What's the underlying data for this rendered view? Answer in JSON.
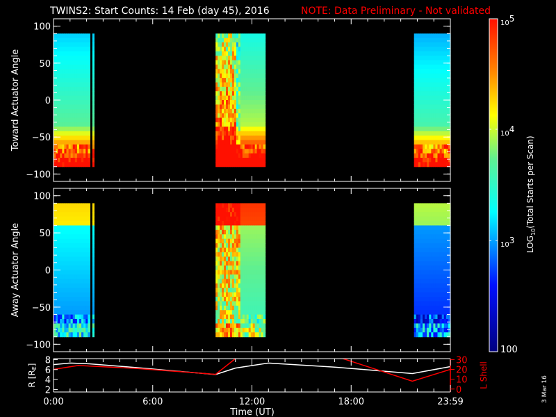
{
  "title": "TWINS2: Start Counts: 14 Feb (day  45), 2016",
  "note": "NOTE: Data Preliminary - Not validated",
  "date_stamp": "3 Mar 16",
  "colors": {
    "note": "#ff0000",
    "axis": "#ffffff",
    "lshell": "#ff0000",
    "r": "#ffffff"
  },
  "chart_data": [
    {
      "type": "heatmap",
      "name": "toward",
      "ylabel": "Toward Actuator Angle",
      "ylim": [
        -110,
        110
      ],
      "yticks": [
        "100",
        "50",
        "0",
        "−50",
        "−100"
      ],
      "ytick_values": [
        100,
        50,
        0,
        -50,
        -100
      ],
      "data_angle_range": [
        -90,
        90
      ],
      "data_intervals_hours": [
        [
          0,
          2.2
        ],
        [
          2.35,
          2.45
        ],
        [
          9.8,
          12.8
        ],
        [
          21.8,
          24
        ]
      ],
      "trend": "low counts (~10^3) near +90, rising to ~10^4.5 below -50"
    },
    {
      "type": "heatmap",
      "name": "away",
      "ylabel": "Away Actuator Angle",
      "ylim": [
        -110,
        110
      ],
      "yticks": [
        "100",
        "50",
        "0",
        "−50",
        "−100"
      ],
      "ytick_values": [
        100,
        50,
        0,
        -50,
        -100
      ],
      "data_angle_range": [
        -90,
        90
      ],
      "data_intervals_hours": [
        [
          0,
          2.2
        ],
        [
          2.35,
          2.45
        ],
        [
          9.8,
          12.8
        ],
        [
          21.8,
          24
        ]
      ],
      "trend": "high counts near +80, decreasing to ~10^3 near -50"
    },
    {
      "type": "line",
      "name": "orbit",
      "xlabel": "Time (UT)",
      "xticks": [
        "0:00",
        "6:00",
        "12:00",
        "18:00",
        "23:59"
      ],
      "xtick_hours": [
        0,
        6,
        12,
        18,
        24
      ],
      "ylabel_left": "R [R",
      "ylabel_left_sub": "E",
      "ylabel_left_close": "]",
      "yticks_left": [
        "8",
        "6",
        "4",
        "2"
      ],
      "ylim_left": [
        1.5,
        8.2
      ],
      "ylabel_right": "L Shell",
      "yticks_right": [
        "30",
        "20",
        "10",
        "0"
      ],
      "ylim_right": [
        -3,
        31
      ],
      "series": [
        {
          "name": "R",
          "axis": "left",
          "x": [
            0,
            1,
            2,
            5,
            9.8,
            11,
            13,
            17,
            21.7,
            24
          ],
          "y": [
            7.0,
            7.3,
            7.2,
            6.4,
            5.0,
            6.3,
            7.3,
            6.5,
            5.2,
            6.6
          ]
        },
        {
          "name": "L Shell",
          "axis": "right",
          "x": [
            0,
            1.5,
            5,
            9.8,
            11
          ],
          "y": [
            20,
            24,
            21,
            15,
            31
          ]
        },
        {
          "name": "L Shell",
          "axis": "right",
          "x": [
            17.5,
            21.7,
            24
          ],
          "y": [
            31,
            8,
            20
          ]
        }
      ]
    }
  ],
  "colorbar": {
    "label_main": "LOG",
    "label_sub": "10",
    "label_rest": "(Total Starts per Scan)",
    "ticks": [
      {
        "base": "10",
        "exp": "5",
        "value": 5
      },
      {
        "base": "10",
        "exp": "4",
        "value": 4
      },
      {
        "base": "10",
        "exp": "3",
        "value": 3
      }
    ],
    "bottom_label": "100",
    "range_log10": [
      2,
      5
    ]
  }
}
